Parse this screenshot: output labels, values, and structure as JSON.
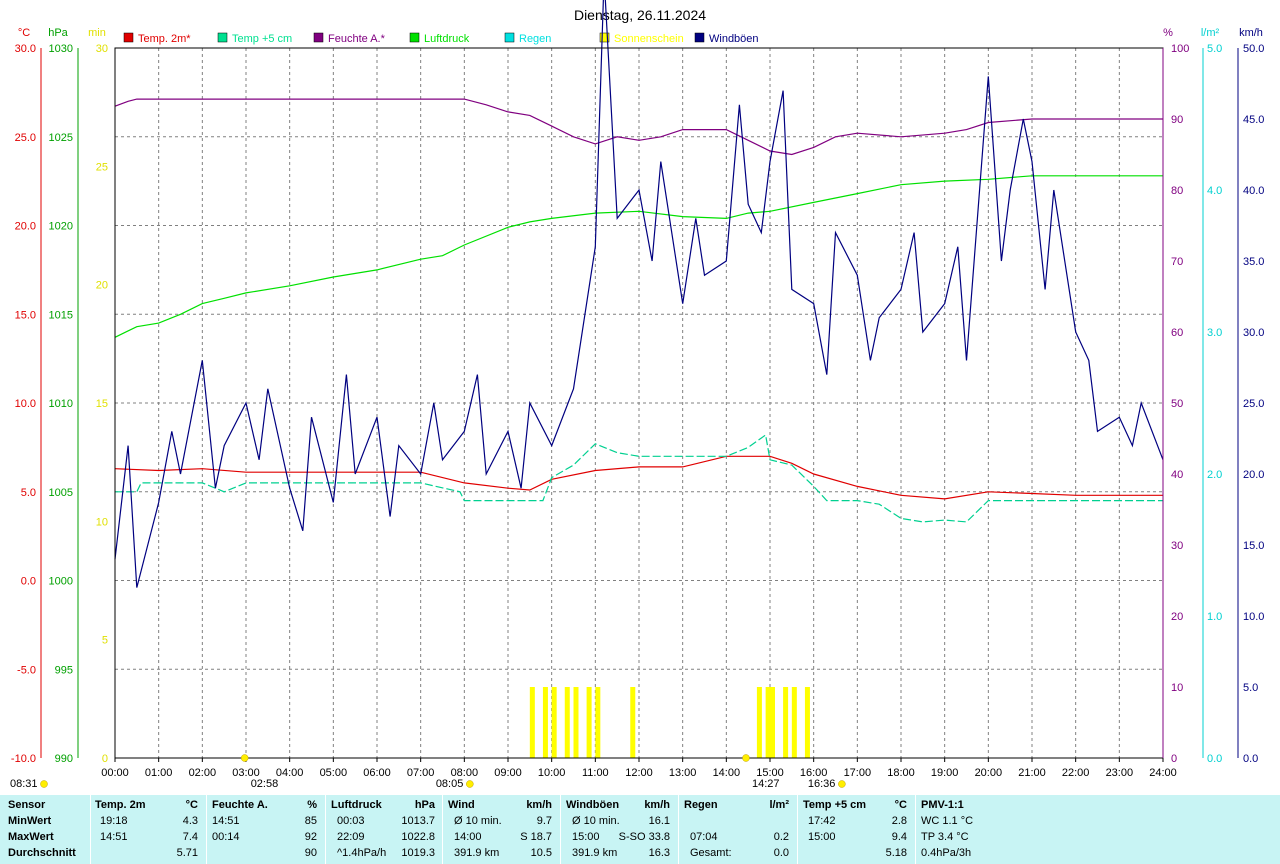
{
  "title": "Dienstag, 26.11.2024",
  "legend": [
    {
      "label": "Temp. 2m*",
      "color": "#e00000"
    },
    {
      "label": "Temp +5 cm",
      "color": "#00e090"
    },
    {
      "label": "Feuchte A.*",
      "color": "#800080"
    },
    {
      "label": "Luftdruck",
      "color": "#00e000"
    },
    {
      "label": "Regen",
      "color": "#00e0e0"
    },
    {
      "label": "Sonnenschein",
      "color": "#ffff00"
    },
    {
      "label": "Windböen",
      "color": "#000080"
    }
  ],
  "axes": {
    "temp": {
      "unit": "°C",
      "ticks": [
        "30.0",
        "25.0",
        "20.0",
        "15.0",
        "10.0",
        "5.0",
        "0.0",
        "-5.0",
        "-10.0"
      ],
      "range": [
        -10,
        30
      ],
      "color": "#e00000"
    },
    "pressure": {
      "unit": "hPa",
      "ticks": [
        "1030",
        "1025",
        "1020",
        "1015",
        "1010",
        "1005",
        "1000",
        "995",
        "990"
      ],
      "range": [
        990,
        1030
      ],
      "color": "#00a000"
    },
    "sun_min": {
      "unit": "min",
      "ticks": [
        "30",
        "25",
        "20",
        "15",
        "10",
        "5",
        "0"
      ],
      "range": [
        0,
        30
      ],
      "color": "#e0e000"
    },
    "humidity": {
      "unit": "%",
      "ticks": [
        "100",
        "90",
        "80",
        "70",
        "60",
        "50",
        "40",
        "30",
        "20",
        "10",
        "0"
      ],
      "range": [
        0,
        100
      ],
      "color": "#800080"
    },
    "rain": {
      "unit": "l/m²",
      "ticks": [
        "5.0",
        "4.0",
        "3.0",
        "2.0",
        "1.0",
        "0.0"
      ],
      "range": [
        0,
        5
      ],
      "color": "#00d0d0"
    },
    "wind": {
      "unit": "km/h",
      "ticks": [
        "50.0",
        "45.0",
        "40.0",
        "35.0",
        "30.0",
        "25.0",
        "20.0",
        "15.0",
        "10.0",
        "5.0",
        "0.0"
      ],
      "range": [
        0,
        50
      ],
      "color": "#000080"
    }
  },
  "x_ticks": [
    "00:00",
    "01:00",
    "02:00",
    "03:00",
    "04:00",
    "05:00",
    "06:00",
    "07:00",
    "08:00",
    "09:00",
    "10:00",
    "11:00",
    "12:00",
    "13:00",
    "14:00",
    "15:00",
    "16:00",
    "17:00",
    "18:00",
    "19:00",
    "20:00",
    "21:00",
    "22:00",
    "23:00",
    "24:00"
  ],
  "markers": [
    {
      "label": "08:31",
      "hour": 0.0,
      "kind": "sunset-icon"
    },
    {
      "label": "02:58",
      "hour": 2.97,
      "kind": "moon-icon"
    },
    {
      "label": "08:05",
      "hour": 8.08,
      "kind": "sunrise-icon"
    },
    {
      "label": "14:27",
      "hour": 14.45,
      "kind": "moon-icon"
    },
    {
      "label": "16:36",
      "hour": 16.6,
      "kind": "sunset-icon"
    }
  ],
  "chart_data": {
    "type": "line",
    "x_unit": "hour",
    "series": [
      {
        "name": "Temp. 2m*",
        "axis": "temp",
        "color": "#e00000",
        "x": [
          0,
          1,
          2,
          3,
          4,
          5,
          6,
          7,
          8,
          9,
          9.5,
          10,
          11,
          12,
          13,
          14,
          15,
          15.5,
          16,
          17,
          18,
          19,
          20,
          21,
          22,
          23,
          24
        ],
        "y": [
          6.3,
          6.2,
          6.3,
          6.1,
          6.1,
          6.1,
          6.1,
          6.1,
          5.5,
          5.2,
          5.1,
          5.7,
          6.2,
          6.4,
          6.4,
          7.0,
          7.0,
          6.6,
          6.0,
          5.3,
          4.8,
          4.6,
          5.0,
          4.9,
          4.8,
          4.8,
          4.8
        ]
      },
      {
        "name": "Temp +5 cm",
        "axis": "temp",
        "color": "#00d090",
        "x": [
          0,
          0.5,
          0.6,
          1,
          2,
          2.5,
          3,
          4,
          5,
          6,
          7,
          7.9,
          8,
          9,
          9.8,
          10,
          10.5,
          11,
          11.5,
          12,
          13,
          14,
          14.5,
          14.9,
          15,
          15.5,
          16,
          16.3,
          17,
          17.5,
          18,
          18.5,
          19,
          19.5,
          20,
          21,
          22,
          23,
          24
        ],
        "y": [
          5.0,
          5.0,
          5.5,
          5.5,
          5.5,
          5.0,
          5.5,
          5.5,
          5.5,
          5.5,
          5.5,
          5.0,
          4.5,
          4.5,
          4.5,
          5.8,
          6.5,
          7.7,
          7.2,
          7.0,
          7.0,
          7.0,
          7.5,
          8.2,
          6.8,
          6.5,
          5.3,
          4.5,
          4.5,
          4.3,
          3.5,
          3.3,
          3.4,
          3.3,
          4.5,
          4.5,
          4.5,
          4.5,
          4.5
        ]
      },
      {
        "name": "Feuchte A.*",
        "axis": "humidity",
        "color": "#800080",
        "x": [
          0,
          0.3,
          0.5,
          1,
          2,
          3,
          4,
          5,
          6,
          7,
          8,
          8.5,
          9,
          9.5,
          10,
          10.5,
          11,
          11.5,
          12,
          12.5,
          13,
          14,
          14.5,
          15,
          15.5,
          16,
          16.5,
          17,
          18,
          19,
          19.5,
          20,
          21,
          22,
          23,
          24
        ],
        "y": [
          91.8,
          92.5,
          92.8,
          92.8,
          92.8,
          92.8,
          92.8,
          92.8,
          92.8,
          92.8,
          92.8,
          92,
          91,
          90.5,
          89,
          87.5,
          86.5,
          87.5,
          87,
          87.5,
          88.5,
          88.5,
          87,
          85.5,
          85,
          86,
          87.5,
          88,
          87.5,
          88,
          88.5,
          89.5,
          90,
          90,
          90,
          90
        ]
      },
      {
        "name": "Luftdruck",
        "axis": "pressure",
        "color": "#00e000",
        "x": [
          0,
          0.5,
          1,
          1.5,
          2,
          2.5,
          3,
          4,
          5,
          6,
          7,
          7.5,
          8,
          9,
          9.5,
          10,
          11,
          12,
          13,
          14,
          14.5,
          15,
          16,
          17,
          18,
          19,
          20,
          21,
          22,
          23,
          24
        ],
        "y": [
          1013.7,
          1014.3,
          1014.5,
          1015.0,
          1015.6,
          1015.9,
          1016.2,
          1016.6,
          1017.1,
          1017.5,
          1018.1,
          1018.3,
          1018.9,
          1019.9,
          1020.2,
          1020.4,
          1020.7,
          1020.8,
          1020.5,
          1020.4,
          1020.7,
          1020.8,
          1021.3,
          1021.8,
          1022.3,
          1022.5,
          1022.6,
          1022.8,
          1022.8,
          1022.8,
          1022.8
        ]
      },
      {
        "name": "Windböen",
        "axis": "wind",
        "color": "#000080",
        "x": [
          0,
          0.3,
          0.5,
          1,
          1.3,
          1.5,
          2,
          2.3,
          2.5,
          3,
          3.3,
          3.5,
          4,
          4.3,
          4.5,
          5,
          5.3,
          5.5,
          6,
          6.3,
          6.5,
          7,
          7.3,
          7.5,
          8,
          8.3,
          8.5,
          9,
          9.3,
          9.5,
          10,
          10.5,
          11,
          11.2,
          11.5,
          12,
          12.3,
          12.5,
          13,
          13.3,
          13.5,
          14,
          14.3,
          14.5,
          14.8,
          15,
          15.3,
          15.5,
          16,
          16.3,
          16.5,
          17,
          17.3,
          17.5,
          18,
          18.3,
          18.5,
          19,
          19.3,
          19.5,
          20,
          20.3,
          20.5,
          20.8,
          21,
          21.3,
          21.5,
          22,
          22.3,
          22.5,
          23,
          23.3,
          23.5,
          24
        ],
        "y": [
          14,
          22,
          12,
          18,
          23,
          20,
          28,
          19,
          22,
          25,
          21,
          26,
          19,
          16,
          24,
          18,
          27,
          20,
          24,
          17,
          22,
          20,
          25,
          21,
          23,
          27,
          20,
          23,
          19,
          25,
          22,
          26,
          36,
          55,
          38,
          40,
          35,
          42,
          32,
          38,
          34,
          35,
          46,
          39,
          37,
          42,
          47,
          33,
          32,
          27,
          37,
          34,
          28,
          31,
          33,
          37,
          30,
          32,
          36,
          28,
          48,
          35,
          40,
          45,
          42,
          33,
          40,
          30,
          28,
          23,
          24,
          22,
          25,
          21
        ]
      },
      {
        "name": "Sonnenschein",
        "axis": "sun_min",
        "color": "#ffff00",
        "type": "bar",
        "x": [
          9.5,
          9.8,
          10.0,
          10.3,
          10.5,
          10.8,
          11.0,
          11.8,
          14.7,
          14.9,
          15.0,
          15.3,
          15.5,
          15.8
        ],
        "y": [
          3,
          3,
          3,
          3,
          3,
          3,
          3,
          3,
          3,
          3,
          3,
          3,
          3,
          3
        ]
      }
    ]
  },
  "stats": {
    "headers": [
      {
        "label": "Sensor"
      },
      {
        "label": "Temp. 2m",
        "unit": "°C"
      },
      {
        "label": "Feuchte A.",
        "unit": "%"
      },
      {
        "label": "Luftdruck",
        "unit": "hPa"
      },
      {
        "label": "Wind",
        "unit": "km/h"
      },
      {
        "label": "Windböen",
        "unit": "km/h"
      },
      {
        "label": "Regen",
        "unit": "l/m²"
      },
      {
        "label": "Temp +5 cm",
        "unit": "°C"
      },
      {
        "label": "PMV-1:1"
      }
    ],
    "rows": [
      {
        "label": "MinWert",
        "cells": [
          [
            "19:18",
            "4.3"
          ],
          [
            "14:51",
            "85"
          ],
          [
            "00:03",
            "1013.7"
          ],
          [
            "Ø 10 min.",
            "9.7"
          ],
          [
            "Ø 10 min.",
            "16.1"
          ],
          [
            "",
            ""
          ],
          [
            "17:42",
            "2.8"
          ],
          [
            "WC 1.1 °C",
            ""
          ]
        ]
      },
      {
        "label": "MaxWert",
        "cells": [
          [
            "14:51",
            "7.4"
          ],
          [
            "00:14",
            "92"
          ],
          [
            "22:09",
            "1022.8"
          ],
          [
            "14:00",
            "S 18.7"
          ],
          [
            "15:00",
            "S-SO 33.8"
          ],
          [
            "07:04",
            "0.2"
          ],
          [
            "15:00",
            "9.4"
          ],
          [
            "TP 3.4 °C",
            ""
          ]
        ]
      },
      {
        "label": "Durchschnitt",
        "cells": [
          [
            "",
            "5.71"
          ],
          [
            "",
            "90"
          ],
          [
            "^1.4hPa/h",
            "1019.3"
          ],
          [
            "391.9 km",
            "10.5"
          ],
          [
            "391.9 km",
            "16.3"
          ],
          [
            "Gesamt:",
            "0.0"
          ],
          [
            "",
            "5.18"
          ],
          [
            "0.4hPa/3h",
            ""
          ]
        ]
      }
    ]
  }
}
